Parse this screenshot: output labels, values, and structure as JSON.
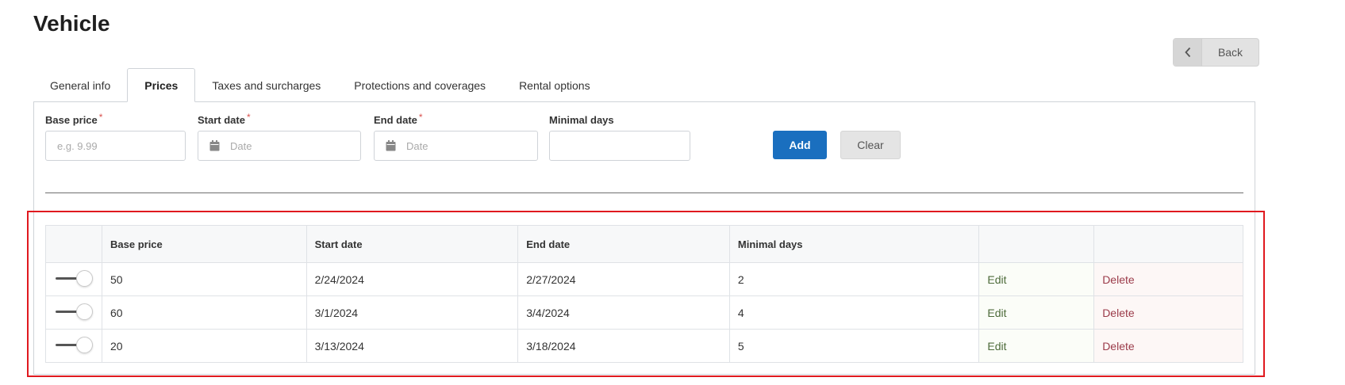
{
  "page": {
    "title": "Vehicle"
  },
  "header": {
    "back_label": "Back"
  },
  "tabs": [
    {
      "label": "General info",
      "active": false
    },
    {
      "label": "Prices",
      "active": true
    },
    {
      "label": "Taxes and surcharges",
      "active": false
    },
    {
      "label": "Protections and coverages",
      "active": false
    },
    {
      "label": "Rental options",
      "active": false
    }
  ],
  "form": {
    "base_price": {
      "label": "Base price",
      "required_mark": "*",
      "placeholder": "e.g. 9.99",
      "value": ""
    },
    "start_date": {
      "label": "Start date",
      "required_mark": "*",
      "placeholder": "Date",
      "value": ""
    },
    "end_date": {
      "label": "End date",
      "required_mark": "*",
      "placeholder": "Date",
      "value": ""
    },
    "minimal_days": {
      "label": "Minimal days",
      "value": ""
    },
    "add_label": "Add",
    "clear_label": "Clear"
  },
  "table": {
    "columns": [
      "Base price",
      "Start date",
      "End date",
      "Minimal days",
      "",
      ""
    ],
    "rows": [
      {
        "base_price": "50",
        "start_date": "2/24/2024",
        "end_date": "2/27/2024",
        "minimal_days": "2",
        "edit": "Edit",
        "delete": "Delete",
        "enabled": true
      },
      {
        "base_price": "60",
        "start_date": "3/1/2024",
        "end_date": "3/4/2024",
        "minimal_days": "4",
        "edit": "Edit",
        "delete": "Delete",
        "enabled": true
      },
      {
        "base_price": "20",
        "start_date": "3/13/2024",
        "end_date": "3/18/2024",
        "minimal_days": "5",
        "edit": "Edit",
        "delete": "Delete",
        "enabled": true
      }
    ]
  },
  "colors": {
    "accent": "#1a6fbf",
    "highlight": "#e0191f",
    "edit": "#4d6b3a",
    "delete": "#9b3b4a"
  },
  "icons": {
    "back": "chevron-left-icon",
    "date": "calendar-icon",
    "toggle": "toggle-switch"
  }
}
